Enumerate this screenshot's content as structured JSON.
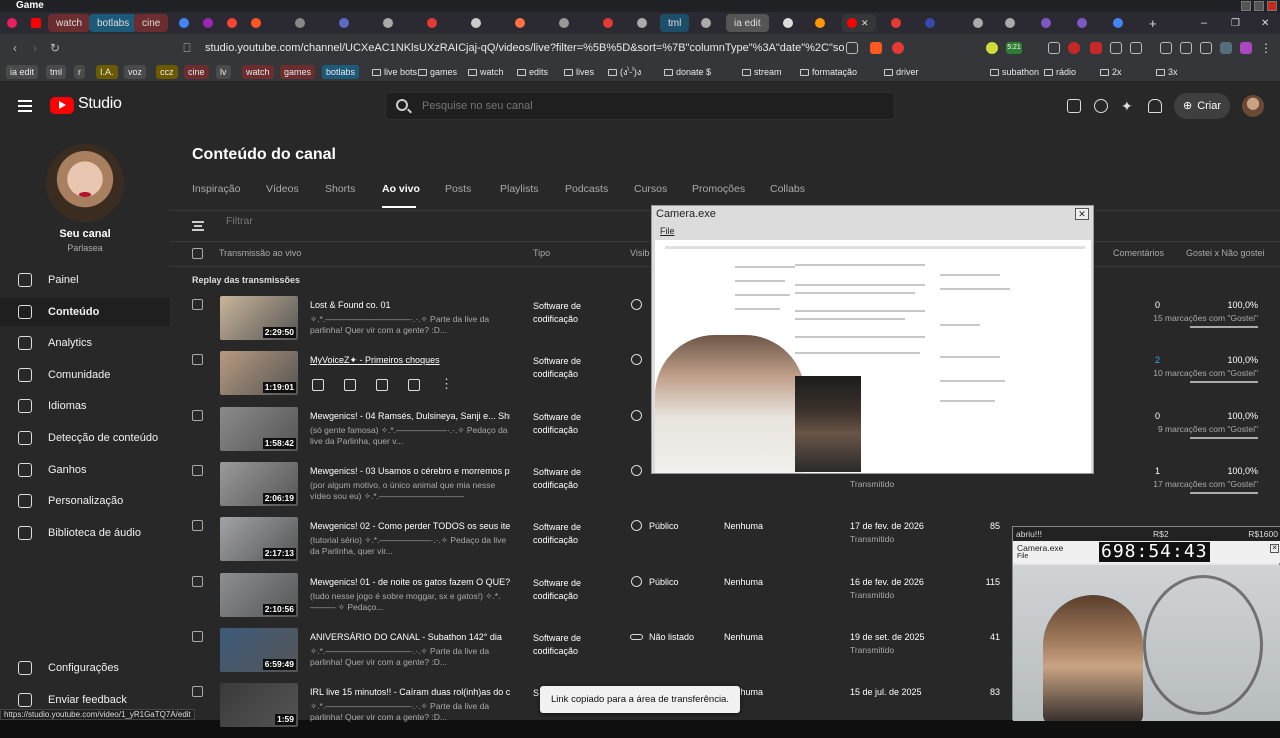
{
  "window": {
    "title": "Game"
  },
  "browser": {
    "labeled_tabs": [
      "watch",
      "botlabs",
      "cine",
      "tml",
      "ia edit"
    ],
    "url": "studio.youtube.com/channel/UCXeAC1NKlsUXzRAICjaj-qQ/videos/live?filter=%5B%5D&sort=%7B\"columnType\"%3A\"date\"%2C\"sortOrder\"%3A\"D...",
    "status_badge": "5:21"
  },
  "bookmarks": [
    {
      "label": "ia edit",
      "color": "#4a4a4a"
    },
    {
      "label": "tml",
      "color": "#4a4a4a"
    },
    {
      "label": "r",
      "color": "#4a4a4a"
    },
    {
      "label": "I.A.",
      "color": "#6b5a00"
    },
    {
      "label": "voz",
      "color": "#4a4a4a"
    },
    {
      "label": "ccz",
      "color": "#6b5a00"
    },
    {
      "label": "cine",
      "color": "#6b2d2d"
    },
    {
      "label": "lv",
      "color": "#4a4a4a"
    },
    {
      "label": "watch",
      "color": "#6b2d2d"
    },
    {
      "label": "games",
      "color": "#6b2d2d"
    },
    {
      "label": "botlabs",
      "color": "#1d5a7a"
    },
    {
      "label": "live bots",
      "color": ""
    },
    {
      "label": "games",
      "color": ""
    },
    {
      "label": "watch",
      "color": ""
    },
    {
      "label": "edits",
      "color": ""
    },
    {
      "label": "lives",
      "color": ""
    },
    {
      "label": "(ง'̀-'́)ง",
      "color": ""
    },
    {
      "label": "donate $",
      "color": ""
    },
    {
      "label": "stream",
      "color": ""
    },
    {
      "label": "formatação",
      "color": ""
    },
    {
      "label": "driver",
      "color": ""
    },
    {
      "label": "subathon",
      "color": ""
    },
    {
      "label": "rádio",
      "color": ""
    },
    {
      "label": "2x",
      "color": ""
    },
    {
      "label": "3x",
      "color": ""
    }
  ],
  "studio": {
    "brand": "Studio",
    "search_placeholder": "Pesquise no seu canal",
    "create_label": "Criar"
  },
  "channel": {
    "title": "Seu canal",
    "handle": "Parlasea"
  },
  "sidebar": {
    "items": [
      {
        "label": "Painel",
        "icon": "dashboard-icon"
      },
      {
        "label": "Conteúdo",
        "icon": "content-icon",
        "active": true
      },
      {
        "label": "Analytics",
        "icon": "analytics-icon"
      },
      {
        "label": "Comunidade",
        "icon": "community-icon"
      },
      {
        "label": "Idiomas",
        "icon": "languages-icon"
      },
      {
        "label": "Detecção de conteúdo",
        "icon": "detection-icon"
      },
      {
        "label": "Ganhos",
        "icon": "earn-icon"
      },
      {
        "label": "Personalização",
        "icon": "customization-icon"
      },
      {
        "label": "Biblioteca de áudio",
        "icon": "audio-library-icon"
      }
    ],
    "bottom": [
      {
        "label": "Configurações",
        "icon": "settings-icon"
      },
      {
        "label": "Enviar feedback",
        "icon": "feedback-icon"
      }
    ]
  },
  "main": {
    "title": "Conteúdo do canal",
    "tabs": [
      "Inspiração",
      "Vídeos",
      "Shorts",
      "Ao vivo",
      "Posts",
      "Playlists",
      "Podcasts",
      "Cursos",
      "Promoções",
      "Collabs"
    ],
    "active_tab": "Ao vivo",
    "filter_placeholder": "Filtrar",
    "columns": {
      "video": "Transmissão ao vivo",
      "type": "Tipo",
      "visibility": "Visib",
      "comments": "Comentários",
      "likes": "Gostei x Não gostei"
    },
    "section": "Replay das transmissões"
  },
  "rows": [
    {
      "title": "Lost & Found co. 01",
      "desc": "✧.*.——————————·.·.✧ Parte da live da parlinha! Quer vir com a gente? :D...",
      "duration": "2:29:50",
      "type": "Software de codificação",
      "visibility": "",
      "restriction": "",
      "date": "",
      "date_sub": "",
      "views": "",
      "comments": "0",
      "likes": "100,0%",
      "likes_sub": "15 marcações com \"Gostei\"",
      "thumb": "#c9b59a"
    },
    {
      "title": "MyVoiceZ✦ - Primeiros choques",
      "desc": "",
      "duration": "1:19:01",
      "type": "Software de codificação",
      "visibility": "",
      "restriction": "",
      "date": "",
      "date_sub": "",
      "views": "",
      "comments": "2",
      "likes": "100,0%",
      "likes_sub": "10 marcações com \"Gostei\"",
      "thumb": "#b89a80",
      "hover": true
    },
    {
      "title": "Mewgenics! - 04 Ramsés, Dulsineya, Sanji e... Shr...",
      "desc": "(só gente famosa) ✧.*.——————·.·.✧ Pedaço da live da Parlinha, quer v...",
      "duration": "1:58:42",
      "type": "Software de codificação",
      "visibility": "",
      "restriction": "",
      "date": "",
      "date_sub": "",
      "views": "",
      "comments": "0",
      "likes": "100,0%",
      "likes_sub": "9 marcações com \"Gostei\"",
      "thumb": "#8a8a8a"
    },
    {
      "title": "Mewgenics! - 03 Usamos o cérebro e morremos p...",
      "desc": "(por algum motivo, o único animal que mia nesse vídeo sou eu) ✧.*.——————————",
      "duration": "2:06:19",
      "type": "Software de codificação",
      "visibility": "",
      "restriction": "",
      "date": "",
      "date_sub": "Transmitido",
      "views": "",
      "comments": "1",
      "likes": "100,0%",
      "likes_sub": "17 marcações com \"Gostei\"",
      "thumb": "#9a9a9a"
    },
    {
      "title": "Mewgenics! 02 - Como perder TODOS os seus ite...",
      "desc": "(tutorial sério) ✧.*.——————·.·.✧ Pedaço da live da Parlinha, quer vir...",
      "duration": "2:17:13",
      "type": "Software de codificação",
      "visibility": "Público",
      "restriction": "Nenhuma",
      "date": "17 de fev. de 2026",
      "date_sub": "Transmitido",
      "views": "85",
      "comments": "",
      "likes": "",
      "likes_sub": "",
      "thumb": "#a0a4a8"
    },
    {
      "title": "Mewgenics! 01 - de noite os gatos fazem O QUE??!",
      "desc": "(tudo nesse jogo é sobre moggar, sx e gatos!) ✧.*.——— ✧ Pedaço...",
      "duration": "2:10:56",
      "type": "Software de codificação",
      "visibility": "Público",
      "restriction": "Nenhuma",
      "date": "16 de fev. de 2026",
      "date_sub": "Transmitido",
      "views": "115",
      "comments": "",
      "likes": "",
      "likes_sub": "",
      "thumb": "#8c8f92"
    },
    {
      "title": "ANIVERSÁRIO DO CANAL - Subathon 142° dia",
      "desc": "✧.*.——————————·.·.✧ Parte da live da parlinha! Quer vir com a gente? :D...",
      "duration": "6:59:49",
      "type": "Software de codificação",
      "visibility": "Não listado",
      "restriction": "Nenhuma",
      "date": "19 de set. de 2025",
      "date_sub": "Transmitido",
      "views": "41",
      "comments": "",
      "likes": "",
      "likes_sub": "",
      "thumb": "#3c5a7a",
      "unlisted": true
    },
    {
      "title": "IRL live 15 minutos!! - Caíram duas rol(inh)as do c...",
      "desc": "✧.*.——————————·.·.✧ Parte da live da parlinha! Quer vir com a gente? :D...",
      "duration": "1:59",
      "type": "S",
      "visibility": "",
      "restriction": "Nenhuma",
      "date": "15 de jul. de 2025",
      "date_sub": "",
      "views": "83",
      "comments": "",
      "likes": "",
      "likes_sub": "",
      "thumb": "#3a3a3a"
    }
  ],
  "camera_window": {
    "title": "Camera.exe",
    "menu": "File"
  },
  "overlay2": {
    "top_left": "abriu!!!",
    "top_mid": "R$2",
    "top_right": "R$1600",
    "title": "Camera.exe",
    "file": "File",
    "timer": "698:54:43"
  },
  "toast": "Link copiado para a área de transferência.",
  "status_url": "https://studio.youtube.com/video/1_yR1GaTQ7A/edit"
}
